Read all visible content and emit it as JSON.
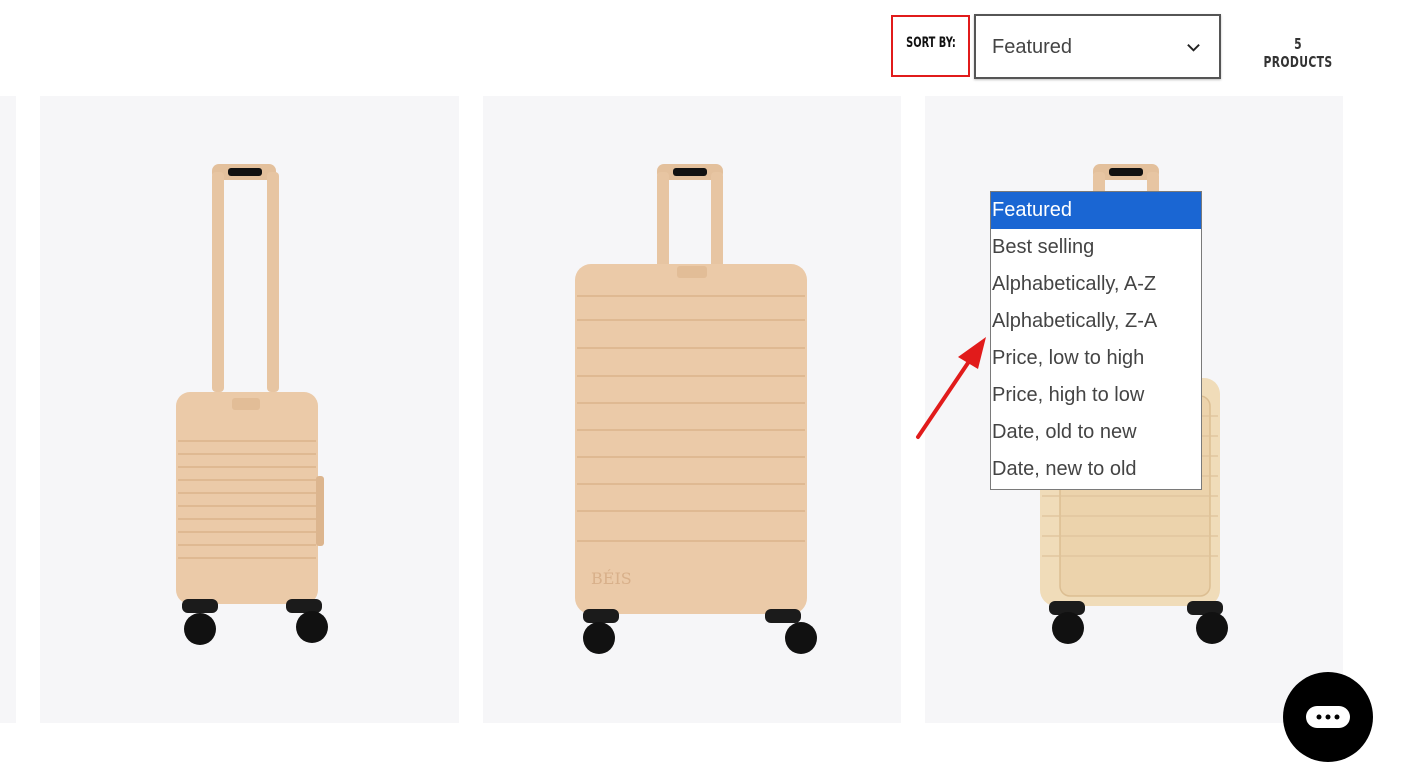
{
  "toolbar": {
    "sort_label": "SORT BY:",
    "sort_value": "Featured",
    "product_count": "5 PRODUCTS"
  },
  "sort_options": [
    {
      "label": "Featured",
      "selected": true
    },
    {
      "label": "Best selling",
      "selected": false
    },
    {
      "label": "Alphabetically, A-Z",
      "selected": false
    },
    {
      "label": "Alphabetically, Z-A",
      "selected": false
    },
    {
      "label": "Price, low to high",
      "selected": false
    },
    {
      "label": "Price, high to low",
      "selected": false
    },
    {
      "label": "Date, old to new",
      "selected": false
    },
    {
      "label": "Date, new to old",
      "selected": false
    }
  ],
  "products": [
    {
      "image": "carry-on-luggage-beige"
    },
    {
      "image": "large-check-in-luggage-beige",
      "brand_mark": "BÉIS"
    },
    {
      "image": "front-pocket-carry-on-beige"
    }
  ],
  "colors": {
    "accent_highlight": "#e11b1b",
    "selected_option": "#1a66d3",
    "card_background": "#f6f6f8",
    "luggage": "#ebcaa8"
  },
  "icons": {
    "select_chevron": "chevron-down-icon",
    "chat": "chat-bubble-icon"
  }
}
